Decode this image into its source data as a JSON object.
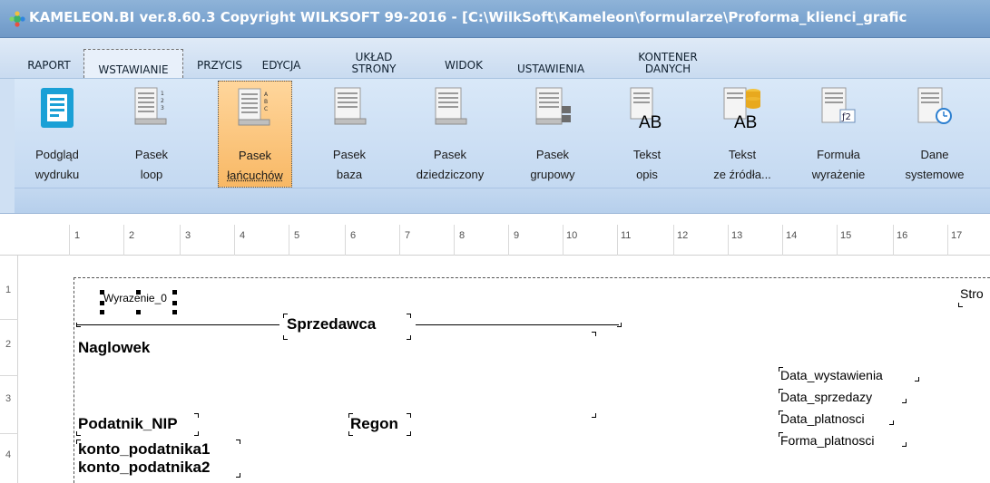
{
  "window": {
    "title": "KAMELEON.BI ver.8.60.3 Copyright WILKSOFT 99-2016 - [C:\\WilkSoft\\Kameleon\\formularze\\Proforma_klienci_grafic"
  },
  "menu": {
    "tabs": [
      {
        "line1": "RAPORT",
        "line2": ""
      },
      {
        "line1": "",
        "line2": "WSTAWIANIE"
      },
      {
        "line1": "PRZYCIS",
        "line2": ""
      },
      {
        "line1": "EDYCJA",
        "line2": ""
      },
      {
        "line1": "UKŁAD",
        "line2": "STRONY"
      },
      {
        "line1": "WIDOK",
        "line2": ""
      },
      {
        "line1": "",
        "line2": "USTAWIENIA"
      },
      {
        "line1": "KONTENER",
        "line2": "DANYCH"
      }
    ],
    "active": "WSTAWIANIE"
  },
  "ribbon": {
    "buttons": [
      {
        "line1": "Podgląd",
        "line2": "wydruku",
        "icon": "print-preview-icon"
      },
      {
        "line1": "Pasek",
        "line2": "loop",
        "icon": "loop-band-icon"
      },
      {
        "line1": "Pasek",
        "line2": "łańcuchów",
        "icon": "chain-band-icon",
        "selected": true
      },
      {
        "line1": "Pasek",
        "line2": "baza",
        "icon": "base-band-icon"
      },
      {
        "line1": "Pasek",
        "line2": "dziedziczony",
        "icon": "inherited-band-icon"
      },
      {
        "line1": "Pasek",
        "line2": "grupowy",
        "icon": "group-band-icon"
      },
      {
        "line1": "Tekst",
        "line2": "opis",
        "icon": "text-label-icon"
      },
      {
        "line1": "Tekst",
        "line2": "ze źródła...",
        "icon": "text-source-icon"
      },
      {
        "line1": "Formuła",
        "line2": "wyrażenie",
        "icon": "formula-icon"
      },
      {
        "line1": "Dane",
        "line2": "systemowe",
        "icon": "system-data-icon"
      }
    ],
    "icon_text": {
      "ab": "AB",
      "f2": "ƒ2"
    }
  },
  "ruler": {
    "horizontal": [
      "1",
      "2",
      "3",
      "4",
      "5",
      "6",
      "7",
      "8",
      "9",
      "10",
      "11",
      "12",
      "13",
      "14",
      "15",
      "16",
      "17"
    ],
    "vertical": [
      "1",
      "2",
      "3",
      "4"
    ]
  },
  "design": {
    "fields": {
      "wyrazenie": "Wyrazenie_0",
      "strona": "Stro",
      "sprzedawca": "Sprzedawca",
      "naglowek": "Naglowek",
      "data_wystawienia": "Data_wystawienia",
      "data_sprzedazy": "Data_sprzedazy",
      "data_platnosci": "Data_platnosci",
      "forma_platnosci": "Forma_platnosci",
      "podatnik_nip": "Podatnik_NIP",
      "regon": "Regon",
      "konto1": "konto_podatnika1",
      "konto2": "konto_podatnika2"
    }
  },
  "colors": {
    "titlebar": "#7aa3cf",
    "ribbon": "#cfe0f3",
    "selected_button": "#f8b865"
  }
}
